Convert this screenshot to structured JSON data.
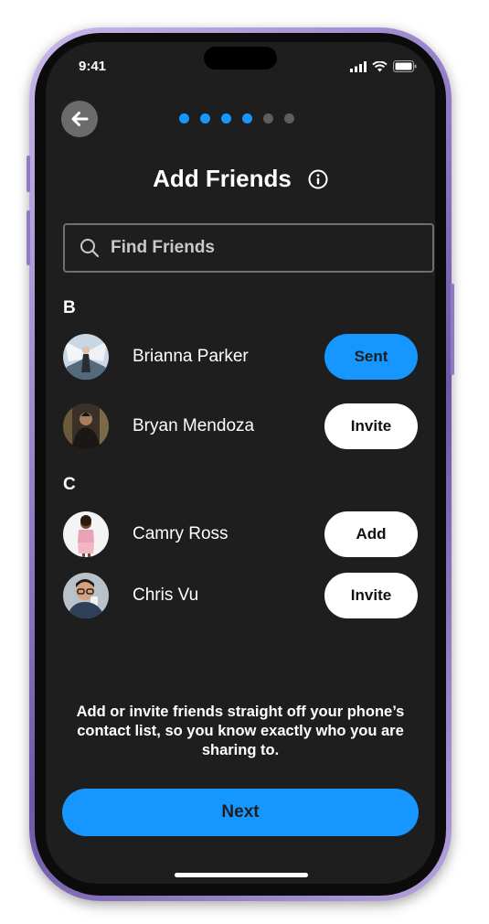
{
  "status_bar": {
    "time": "9:41"
  },
  "progress": {
    "total_steps": 6,
    "current_step": 4
  },
  "header": {
    "title": "Add Friends"
  },
  "search": {
    "placeholder": "Find Friends",
    "value": ""
  },
  "sections": [
    {
      "letter": "B",
      "contacts": [
        {
          "name": "Brianna Parker",
          "action": "Sent"
        },
        {
          "name": "Bryan Mendoza",
          "action": "Invite"
        }
      ]
    },
    {
      "letter": "C",
      "contacts": [
        {
          "name": "Camry Ross",
          "action": "Add"
        },
        {
          "name": "Chris Vu",
          "action": "Invite"
        }
      ]
    }
  ],
  "footer": {
    "description": "Add or invite friends straight off your phone’s contact list, so you know exactly who you are sharing to.",
    "next_label": "Next"
  },
  "colors": {
    "accent": "#1597ff",
    "screen_bg": "#1e1e1f",
    "frame": "#8f7ac4"
  }
}
